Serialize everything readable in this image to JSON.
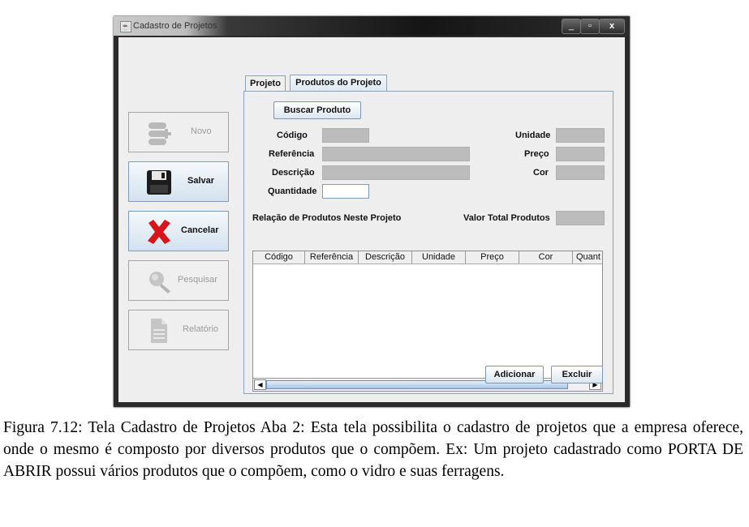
{
  "window": {
    "title": "Cadastro de Projetos",
    "controls": {
      "minimize": "_",
      "maximize": "▫",
      "close": "x"
    }
  },
  "sidebar": {
    "buttons": [
      {
        "label": "Novo",
        "icon": "new-icon",
        "enabled": false
      },
      {
        "label": "Salvar",
        "icon": "floppy-disk-icon",
        "enabled": true
      },
      {
        "label": "Cancelar",
        "icon": "red-x-icon",
        "enabled": true
      },
      {
        "label": "Pesquisar",
        "icon": "magnifier-icon",
        "enabled": false
      },
      {
        "label": "Relatório",
        "icon": "document-icon",
        "enabled": false
      }
    ]
  },
  "tabs": [
    {
      "label": "Projeto",
      "selected": false
    },
    {
      "label": "Produtos do Projeto",
      "selected": true
    }
  ],
  "form": {
    "search_button": "Buscar Produto",
    "codigo_label": "Código",
    "referencia_label": "Referência",
    "descricao_label": "Descrição",
    "quantidade_label": "Quantidade",
    "unidade_label": "Unidade",
    "preco_label": "Preço",
    "cor_label": "Cor",
    "list_title": "Relação de Produtos Neste Projeto",
    "total_label": "Valor Total  Produtos"
  },
  "table": {
    "columns": [
      "Código",
      "Referência",
      "Descrição",
      "Unidade",
      "Preço",
      "Cor",
      "Quant"
    ],
    "rows": []
  },
  "actions": {
    "add": "Adicionar",
    "delete": "Excluir"
  },
  "caption": "Figura 7.12: Tela Cadastro de Projetos Aba 2: Esta tela possibilita o cadastro de projetos que a empresa oferece, onde o mesmo é composto por diversos produtos que o compõem. Ex: Um projeto cadastrado como PORTA DE ABRIR possui vários produtos que o compõem, como o vidro e suas ferragens.",
  "colors": {
    "accent": "#8aa2ba",
    "disabled_field": "#bcbcbc",
    "cancel_red": "#d8141a"
  }
}
